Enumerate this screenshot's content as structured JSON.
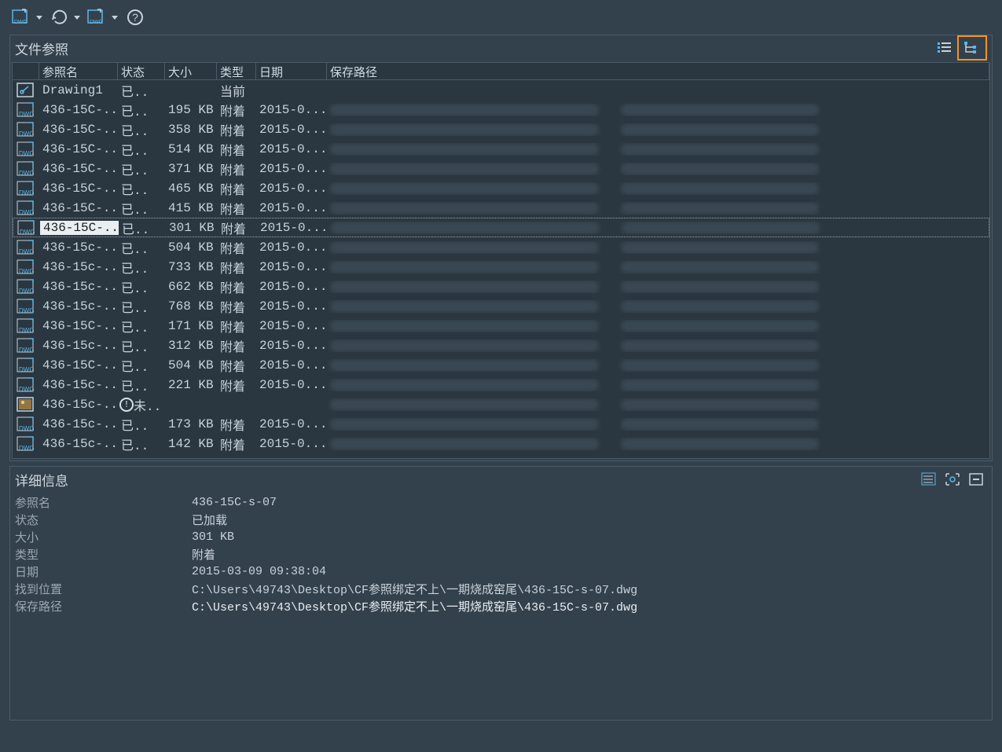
{
  "panels": {
    "file_refs_title": "文件参照",
    "details_title": "详细信息"
  },
  "columns": {
    "name": "参照名",
    "status": "状态",
    "size": "大小",
    "type": "类型",
    "date": "日期",
    "path": "保存路径"
  },
  "rows": [
    {
      "icon": "drawing",
      "name": "Drawing1",
      "status": "已..",
      "size": "",
      "type": "当前",
      "date": "",
      "blur": false,
      "selected": false,
      "warn": false
    },
    {
      "icon": "dwg",
      "name": "436-15C-...",
      "status": "已..",
      "size": "195 KB",
      "type": "附着",
      "date": "2015-0...",
      "blur": true,
      "selected": false,
      "warn": false
    },
    {
      "icon": "dwg",
      "name": "436-15C-...",
      "status": "已..",
      "size": "358 KB",
      "type": "附着",
      "date": "2015-0...",
      "blur": true,
      "selected": false,
      "warn": false
    },
    {
      "icon": "dwg",
      "name": "436-15C-...",
      "status": "已..",
      "size": "514 KB",
      "type": "附着",
      "date": "2015-0...",
      "blur": true,
      "selected": false,
      "warn": false
    },
    {
      "icon": "dwg",
      "name": "436-15C-...",
      "status": "已..",
      "size": "371 KB",
      "type": "附着",
      "date": "2015-0...",
      "blur": true,
      "selected": false,
      "warn": false
    },
    {
      "icon": "dwg",
      "name": "436-15C-...",
      "status": "已..",
      "size": "465 KB",
      "type": "附着",
      "date": "2015-0...",
      "blur": true,
      "selected": false,
      "warn": false
    },
    {
      "icon": "dwg",
      "name": "436-15C-...",
      "status": "已..",
      "size": "415 KB",
      "type": "附着",
      "date": "2015-0...",
      "blur": true,
      "selected": false,
      "warn": false
    },
    {
      "icon": "dwg",
      "name": "436-15C-...",
      "status": "已..",
      "size": "301 KB",
      "type": "附着",
      "date": "2015-0...",
      "blur": true,
      "selected": true,
      "warn": false
    },
    {
      "icon": "dwg",
      "name": "436-15c-...",
      "status": "已..",
      "size": "504 KB",
      "type": "附着",
      "date": "2015-0...",
      "blur": true,
      "selected": false,
      "warn": false
    },
    {
      "icon": "dwg",
      "name": "436-15c-...",
      "status": "已..",
      "size": "733 KB",
      "type": "附着",
      "date": "2015-0...",
      "blur": true,
      "selected": false,
      "warn": false
    },
    {
      "icon": "dwg",
      "name": "436-15c-...",
      "status": "已..",
      "size": "662 KB",
      "type": "附着",
      "date": "2015-0...",
      "blur": true,
      "selected": false,
      "warn": false
    },
    {
      "icon": "dwg",
      "name": "436-15c-...",
      "status": "已..",
      "size": "768 KB",
      "type": "附着",
      "date": "2015-0...",
      "blur": true,
      "selected": false,
      "warn": false
    },
    {
      "icon": "dwg",
      "name": "436-15C-...",
      "status": "已..",
      "size": "171 KB",
      "type": "附着",
      "date": "2015-0...",
      "blur": true,
      "selected": false,
      "warn": false
    },
    {
      "icon": "dwg",
      "name": "436-15c-...",
      "status": "已..",
      "size": "312 KB",
      "type": "附着",
      "date": "2015-0...",
      "blur": true,
      "selected": false,
      "warn": false
    },
    {
      "icon": "dwg",
      "name": "436-15C-...",
      "status": "已..",
      "size": "504 KB",
      "type": "附着",
      "date": "2015-0...",
      "blur": true,
      "selected": false,
      "warn": false
    },
    {
      "icon": "dwg",
      "name": "436-15c-...",
      "status": "已..",
      "size": "221 KB",
      "type": "附着",
      "date": "2015-0...",
      "blur": true,
      "selected": false,
      "warn": false
    },
    {
      "icon": "img",
      "name": "436-15c-...",
      "status": "未..",
      "size": "",
      "type": "",
      "date": "",
      "blur": true,
      "selected": false,
      "warn": true
    },
    {
      "icon": "dwg",
      "name": "436-15c-...",
      "status": "已..",
      "size": "173 KB",
      "type": "附着",
      "date": "2015-0...",
      "blur": true,
      "selected": false,
      "warn": false
    },
    {
      "icon": "dwg",
      "name": "436-15c-...",
      "status": "已..",
      "size": "142 KB",
      "type": "附着",
      "date": "2015-0...",
      "blur": true,
      "selected": false,
      "warn": false
    }
  ],
  "details": {
    "labels": {
      "name": "参照名",
      "status": "状态",
      "size": "大小",
      "type": "类型",
      "date": "日期",
      "found": "找到位置",
      "path": "保存路径"
    },
    "values": {
      "name": "436-15C-s-07",
      "status": "已加载",
      "size": "301 KB",
      "type": "附着",
      "date": "2015-03-09 09:38:04",
      "found": "C:\\Users\\49743\\Desktop\\CF参照绑定不上\\一期烧成窑尾\\436-15C-s-07.dwg",
      "path": "C:\\Users\\49743\\Desktop\\CF参照绑定不上\\一期烧成窑尾\\436-15C-s-07.dwg"
    }
  }
}
